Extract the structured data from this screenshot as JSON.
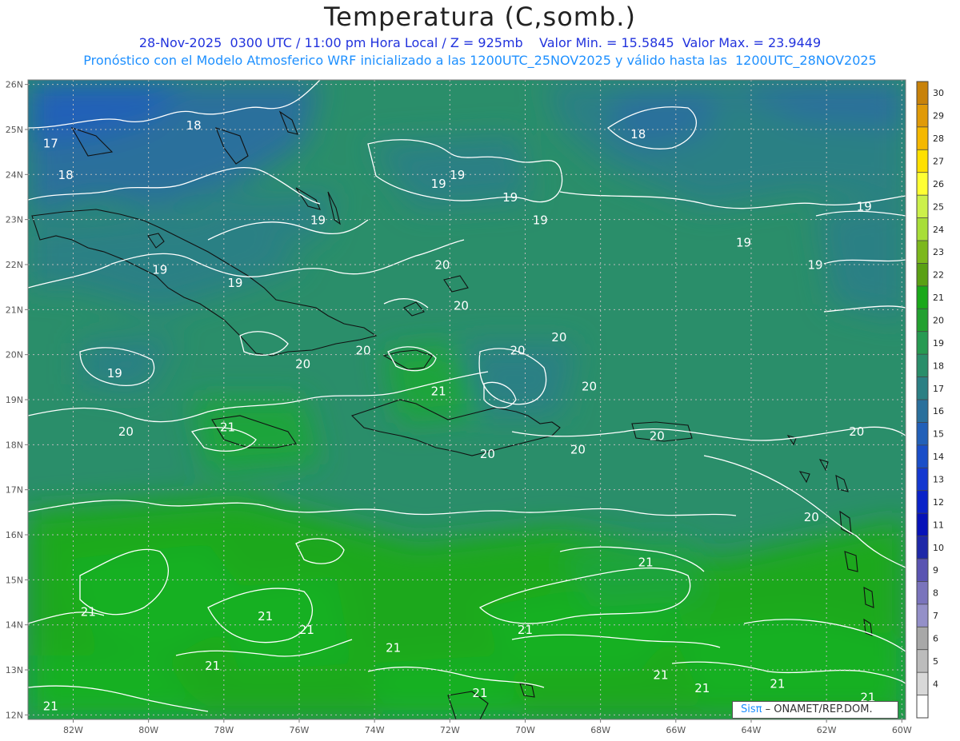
{
  "header": {
    "title": "Temperatura (C,somb.)",
    "subtitle_line1": "28-Nov-2025  0300 UTC / 11:00 pm Hora Local / Z = 925mb    Valor Min. = 15.5845  Valor Max. = 23.9449",
    "subtitle_line2": "Pronostico con el Modelo Atmosferico WRF inicializado a las 1200UTC_25NOV2025 y valido hasta las  1200UTC_28NOV2025",
    "subtitle_line2_display": "Pronóstico con el Modelo Atmosferico WRF inicializado a las 1200UTC_25NOV2025 y válido hasta las  1200UTC_28NOV2025"
  },
  "map": {
    "lon_range": [
      -83.2,
      -59.9
    ],
    "lat_range": [
      11.9,
      26.1
    ],
    "lat_labels": [
      "26N",
      "25N",
      "24N",
      "23N",
      "22N",
      "21N",
      "20N",
      "19N",
      "18N",
      "17N",
      "16N",
      "15N",
      "14N",
      "13N",
      "12N"
    ],
    "lon_labels": [
      "82W",
      "80W",
      "78W",
      "76W",
      "74W",
      "72W",
      "70W",
      "68W",
      "66W",
      "64W",
      "62W",
      "60W"
    ],
    "contour_labels": [
      {
        "text": "17",
        "lon": -82.6,
        "lat": 24.6
      },
      {
        "text": "18",
        "lon": -78.8,
        "lat": 25.0
      },
      {
        "text": "18",
        "lon": -82.2,
        "lat": 23.9
      },
      {
        "text": "18",
        "lon": -67.0,
        "lat": 24.8
      },
      {
        "text": "19",
        "lon": -72.3,
        "lat": 23.7
      },
      {
        "text": "19",
        "lon": -71.8,
        "lat": 23.9
      },
      {
        "text": "19",
        "lon": -75.5,
        "lat": 22.9
      },
      {
        "text": "19",
        "lon": -70.4,
        "lat": 23.4
      },
      {
        "text": "19",
        "lon": -69.6,
        "lat": 22.9
      },
      {
        "text": "19",
        "lon": -61.0,
        "lat": 23.2
      },
      {
        "text": "19",
        "lon": -64.2,
        "lat": 22.4
      },
      {
        "text": "19",
        "lon": -62.3,
        "lat": 21.9
      },
      {
        "text": "19",
        "lon": -79.7,
        "lat": 21.8
      },
      {
        "text": "19",
        "lon": -77.7,
        "lat": 21.5
      },
      {
        "text": "19",
        "lon": -80.9,
        "lat": 19.5
      },
      {
        "text": "20",
        "lon": -72.2,
        "lat": 21.9
      },
      {
        "text": "20",
        "lon": -71.7,
        "lat": 21.0
      },
      {
        "text": "20",
        "lon": -74.3,
        "lat": 20.0
      },
      {
        "text": "20",
        "lon": -75.9,
        "lat": 19.7
      },
      {
        "text": "20",
        "lon": -70.2,
        "lat": 20.0
      },
      {
        "text": "20",
        "lon": -69.1,
        "lat": 20.3
      },
      {
        "text": "20",
        "lon": -68.3,
        "lat": 19.2
      },
      {
        "text": "20",
        "lon": -80.6,
        "lat": 18.2
      },
      {
        "text": "20",
        "lon": -71.0,
        "lat": 17.7
      },
      {
        "text": "20",
        "lon": -68.6,
        "lat": 17.8
      },
      {
        "text": "20",
        "lon": -66.5,
        "lat": 18.1
      },
      {
        "text": "20",
        "lon": -61.2,
        "lat": 18.2
      },
      {
        "text": "20",
        "lon": -62.4,
        "lat": 16.3
      },
      {
        "text": "21",
        "lon": -72.3,
        "lat": 19.1
      },
      {
        "text": "21",
        "lon": -77.9,
        "lat": 18.3
      },
      {
        "text": "21",
        "lon": -66.8,
        "lat": 15.3
      },
      {
        "text": "21",
        "lon": -81.6,
        "lat": 14.2
      },
      {
        "text": "21",
        "lon": -76.9,
        "lat": 14.1
      },
      {
        "text": "21",
        "lon": -75.8,
        "lat": 13.8
      },
      {
        "text": "21",
        "lon": -73.5,
        "lat": 13.4
      },
      {
        "text": "21",
        "lon": -78.3,
        "lat": 13.0
      },
      {
        "text": "21",
        "lon": -70.0,
        "lat": 13.8
      },
      {
        "text": "21",
        "lon": -66.4,
        "lat": 12.8
      },
      {
        "text": "21",
        "lon": -71.2,
        "lat": 12.4
      },
      {
        "text": "21",
        "lon": -65.3,
        "lat": 12.5
      },
      {
        "text": "21",
        "lon": -63.3,
        "lat": 12.6
      },
      {
        "text": "21",
        "lon": -60.9,
        "lat": 12.3
      },
      {
        "text": "21",
        "lon": -82.6,
        "lat": 12.1
      }
    ]
  },
  "colorbar": {
    "labels": [
      "30",
      "29",
      "28",
      "27",
      "26",
      "25",
      "24",
      "23",
      "22",
      "21",
      "20",
      "19",
      "18",
      "17",
      "16",
      "15",
      "14",
      "13",
      "12",
      "11",
      "10",
      "9",
      "8",
      "7",
      "6",
      "5",
      "4"
    ],
    "colors": [
      "#c8820a",
      "#e09a08",
      "#f5b800",
      "#ffe000",
      "#ffff33",
      "#ccf04a",
      "#a8de38",
      "#7cb81c",
      "#5aa014",
      "#1aa81a",
      "#22a030",
      "#279a52",
      "#2a8e6a",
      "#2c8084",
      "#2a709c",
      "#2260b8",
      "#1a4ec8",
      "#1438d0",
      "#0a22c8",
      "#0612b8",
      "#1e28a8",
      "#5a54b2",
      "#7a74bc",
      "#9490c8",
      "#a8a8a8",
      "#bcbcbc",
      "#d8d8d8",
      "#ffffff"
    ]
  },
  "credit": {
    "brand": "Sisπ",
    "text": " ONAMET/REP.DOM."
  }
}
